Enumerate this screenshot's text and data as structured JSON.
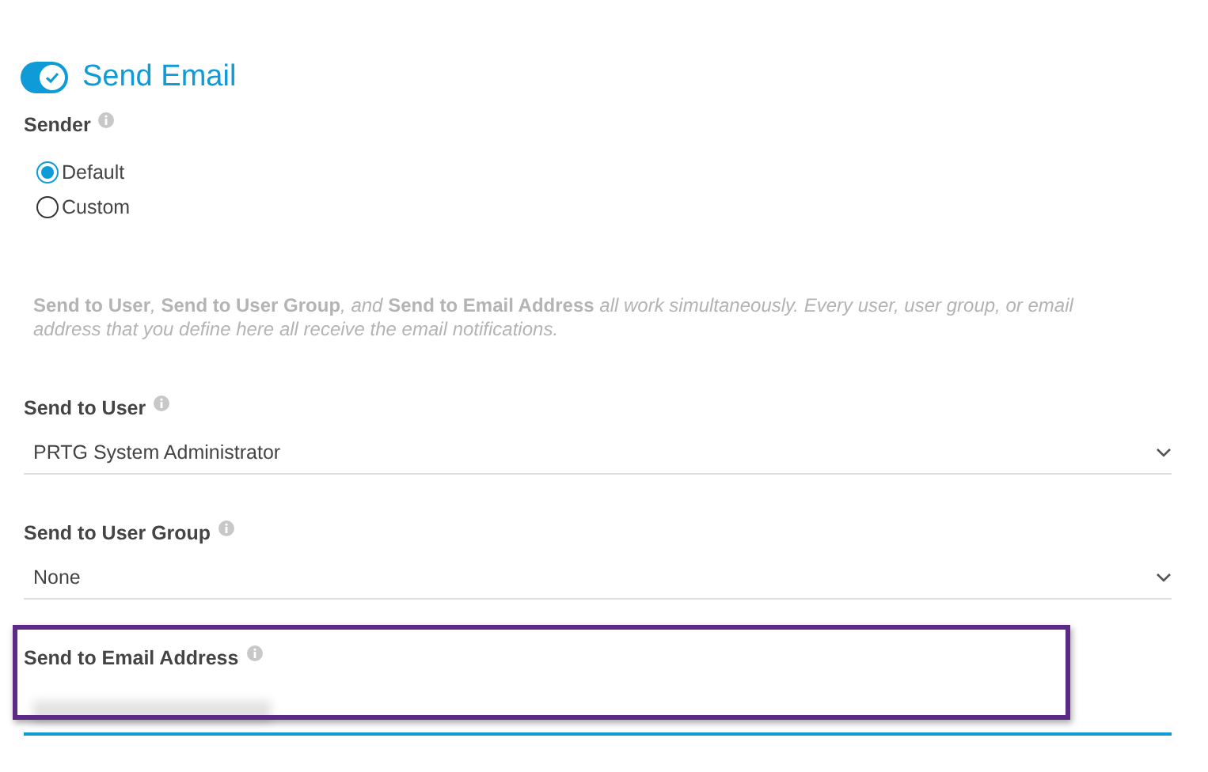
{
  "header": {
    "label": "Send Email",
    "on": true
  },
  "sender": {
    "label": "Sender",
    "options": [
      {
        "label": "Default",
        "selected": true
      },
      {
        "label": "Custom",
        "selected": false
      }
    ]
  },
  "note": "**Send to User**, **Send to User Group**, and **Send to Email Address** all work simultaneously. Every user, user group, or email address that you define here all receive the email notifications.",
  "fields": [
    {
      "kind": "select",
      "label": "Send to User",
      "value": "PRTG System Administrator"
    },
    {
      "kind": "select",
      "label": "Send to User Group",
      "value": "None"
    },
    {
      "kind": "text",
      "label": "Send to Email Address",
      "focused": true,
      "highlighted": true
    }
  ]
}
